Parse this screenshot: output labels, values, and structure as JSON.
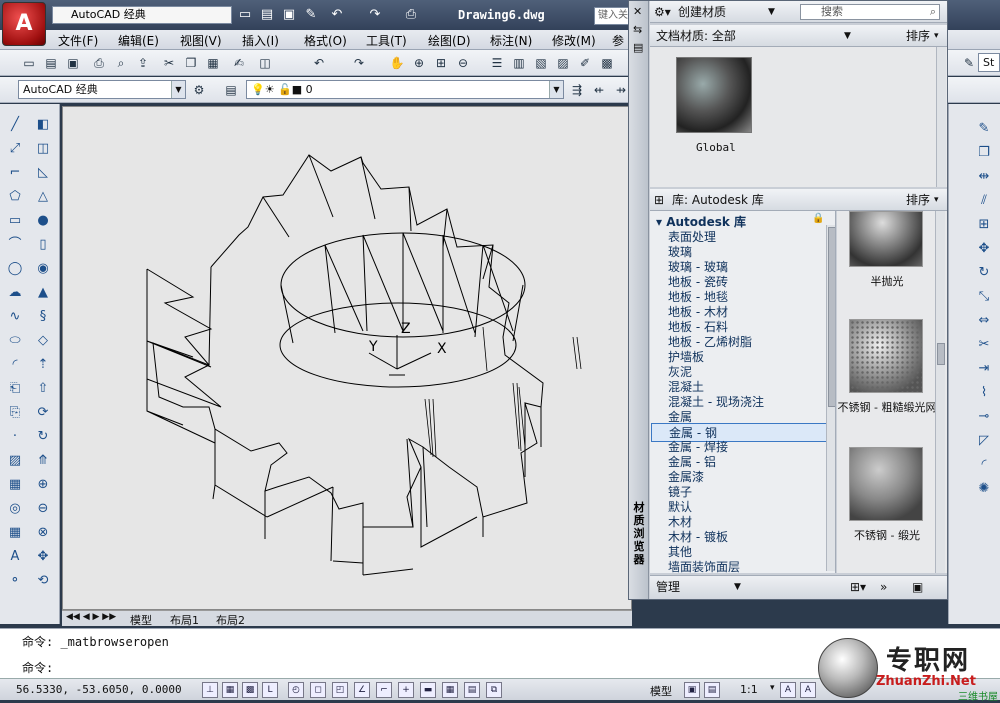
{
  "titlebar": {
    "app_button_label": "A",
    "workspace": "AutoCAD 经典",
    "document_title": "Drawing6.dwg",
    "search_placeholder": "键入关键字"
  },
  "menu": [
    "文件(F)",
    "编辑(E)",
    "视图(V)",
    "插入(I)",
    "格式(O)",
    "工具(T)",
    "绘图(D)",
    "标注(N)",
    "修改(M)",
    "参"
  ],
  "toolbar2": {
    "workspace_combo": "AutoCAD 经典",
    "layer_value": "0",
    "right_combo_fragment": "St"
  },
  "canvas": {
    "ucs_labels": {
      "x": "X",
      "y": "Y",
      "z": "Z"
    }
  },
  "layout_tabs": [
    "模型",
    "布局1",
    "布局2"
  ],
  "command_line": {
    "history": "命令: _matbrowseropen",
    "prompt": "命令:"
  },
  "statusbar": {
    "coordinates": "56.5330,  -53.6050, 0.0000",
    "model_label": "模型",
    "scale": "1:1"
  },
  "materials_browser": {
    "vertical_title": "材质浏览器",
    "create_material_label": "创建材质",
    "search_placeholder": "搜索",
    "document_materials_label": "文档材质: 全部",
    "sort_label": "排序",
    "document_materials": [
      {
        "name": "Global"
      }
    ],
    "library_label": "库: Autodesk 库",
    "library_sort_label": "排序",
    "tree_root": "Autodesk 库",
    "tree_items": [
      "表面处理",
      "玻璃",
      "玻璃 - 玻璃",
      "地板 - 瓷砖",
      "地板 - 地毯",
      "地板 - 木材",
      "地板 - 石料",
      "地板 - 乙烯树脂",
      "护墙板",
      "灰泥",
      "混凝土",
      "混凝土 - 现场浇注",
      "金属",
      "金属 - 钢",
      "金属 - 焊接",
      "金属 - 铝",
      "金属漆",
      "镜子",
      "默认",
      "木材",
      "木材 - 镀板",
      "其他",
      "墙面装饰面层"
    ],
    "selected_item": "金属 - 钢",
    "swatches": [
      {
        "label": "半抛光"
      },
      {
        "label": "不锈钢 - 粗糙缎光网"
      },
      {
        "label": "不锈钢 - 缎光"
      }
    ],
    "manage_label": "管理"
  },
  "watermark": {
    "brand": "专职网",
    "url": "ZhuanZhi.Net",
    "subtitle": "三维书屋"
  }
}
